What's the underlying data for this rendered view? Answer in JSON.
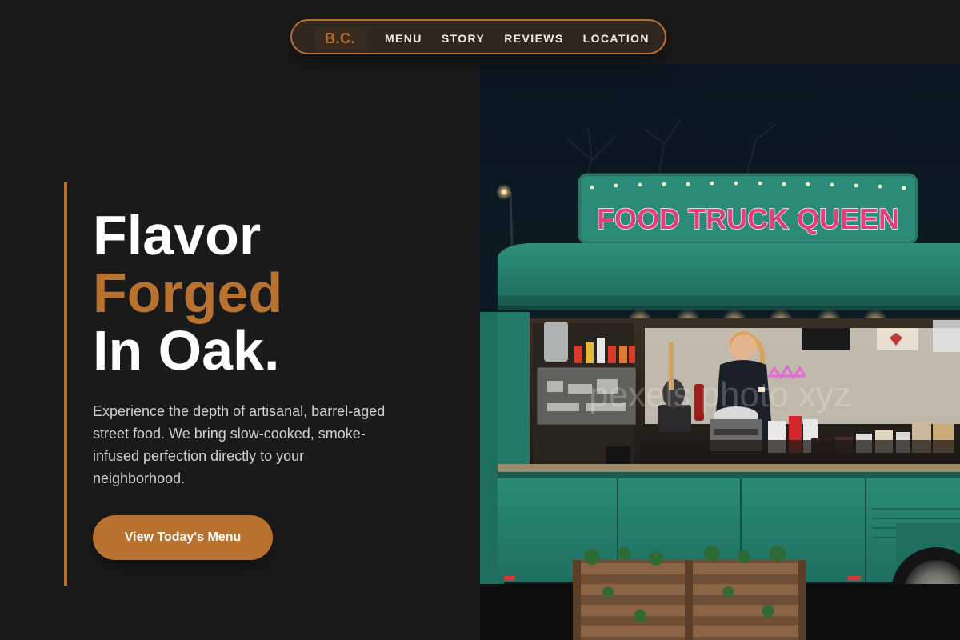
{
  "nav": {
    "logo": "B.C.",
    "links": [
      "MENU",
      "STORY",
      "REVIEWS",
      "LOCATION"
    ]
  },
  "hero": {
    "headline_line1": "Flavor",
    "headline_line2": "Forged",
    "headline_line3": "In Oak.",
    "description": "Experience the depth of artisanal, barrel-aged street food. We bring slow-cooked, smoke-infused perfection directly to your neighborhood.",
    "cta_label": "View Today's Menu"
  },
  "image": {
    "sign_text": "FOOD TRUCK QUEEN",
    "watermark": "pexels photo xyz"
  },
  "colors": {
    "background": "#1b1a1a",
    "accent": "#b8712f",
    "text_primary": "#ffffff",
    "text_secondary": "#d3cec8",
    "truck_teal": "#2f8b7a"
  }
}
